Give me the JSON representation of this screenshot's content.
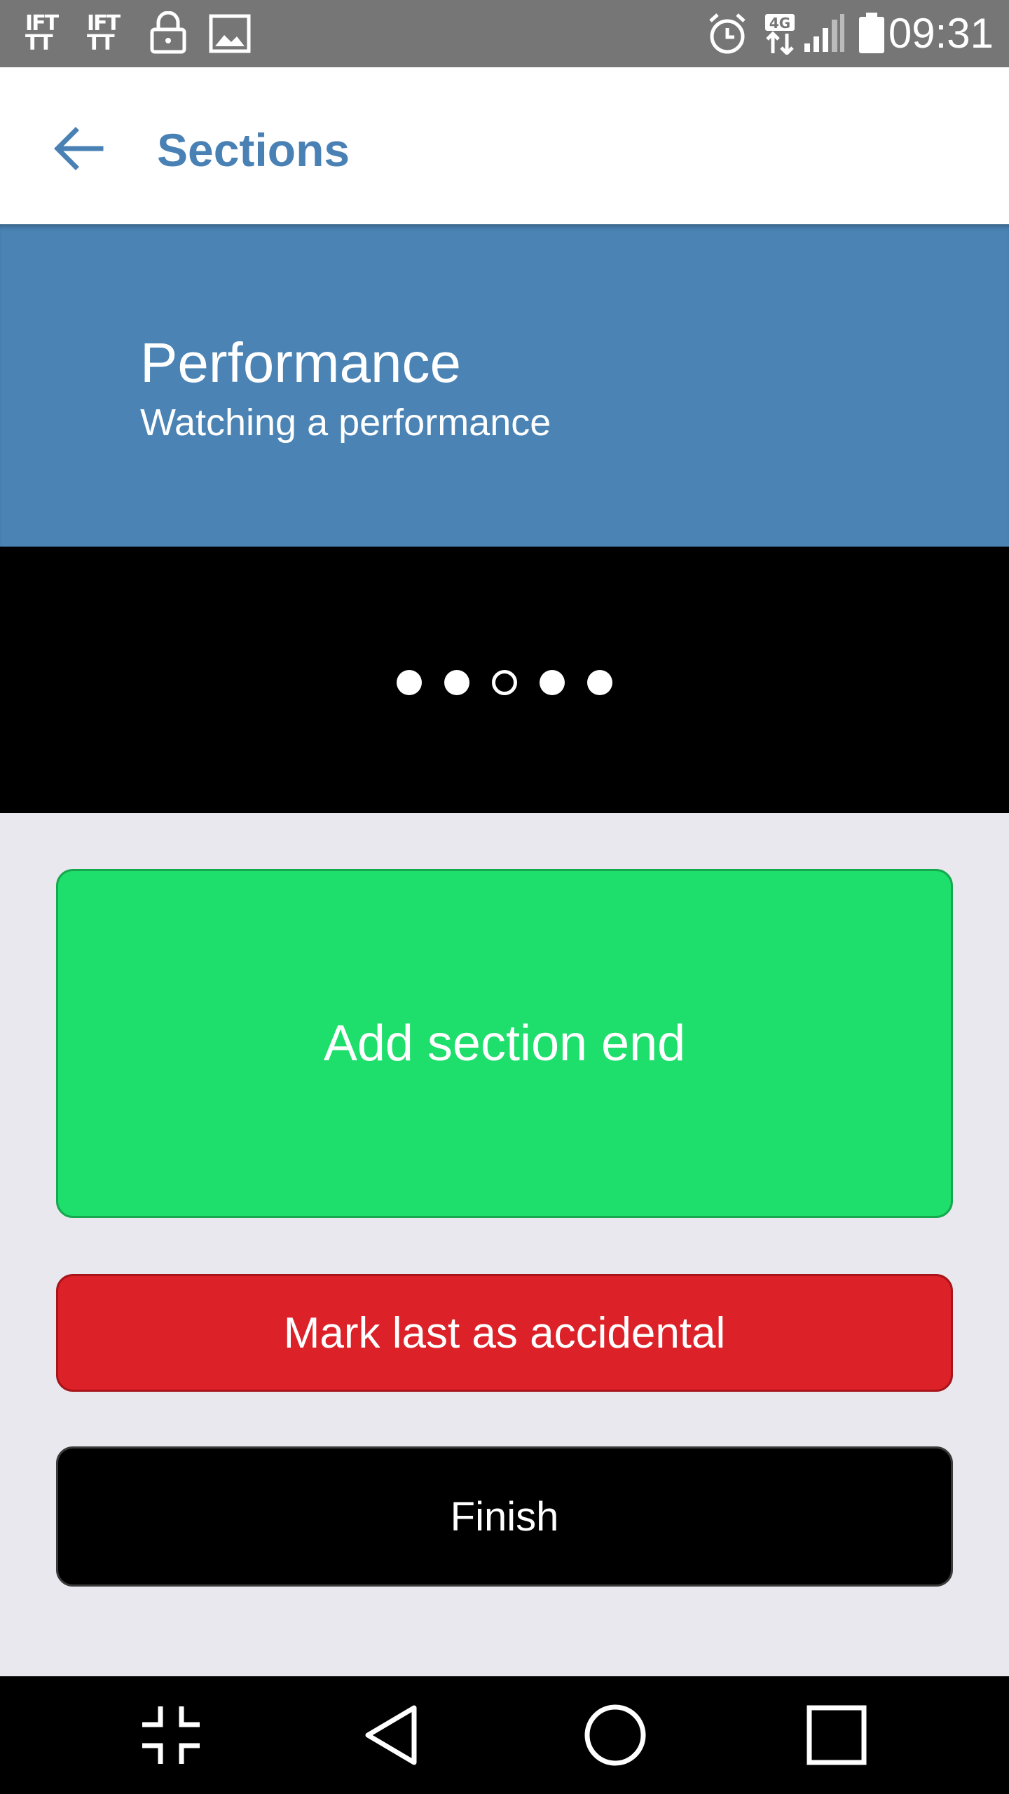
{
  "status_bar": {
    "time": "09:31",
    "network_label": "4G",
    "notification_icons": [
      "ifttt-icon",
      "ifttt-icon",
      "lock-icon",
      "image-icon"
    ],
    "system_icons": [
      "alarm-icon",
      "network-4g-icon",
      "signal-icon",
      "battery-icon"
    ]
  },
  "app_bar": {
    "title": "Sections",
    "back_icon": "arrow-left-icon"
  },
  "section": {
    "title": "Performance",
    "subtitle": "Watching a performance"
  },
  "pager": {
    "count": 5,
    "active_index": 2
  },
  "actions": {
    "add_section_end": "Add section end",
    "mark_accidental": "Mark last as accidental",
    "finish": "Finish"
  },
  "nav_bar": {
    "items": [
      "collapse-icon",
      "back-triangle-icon",
      "home-circle-icon",
      "recents-square-icon"
    ]
  },
  "colors": {
    "status_bar": "#767676",
    "accent": "#4a81b4",
    "header_bg": "#4a83b4",
    "green": "#1ede6c",
    "red": "#dc2128",
    "black": "#000000",
    "content_bg": "#e8e8ee"
  }
}
